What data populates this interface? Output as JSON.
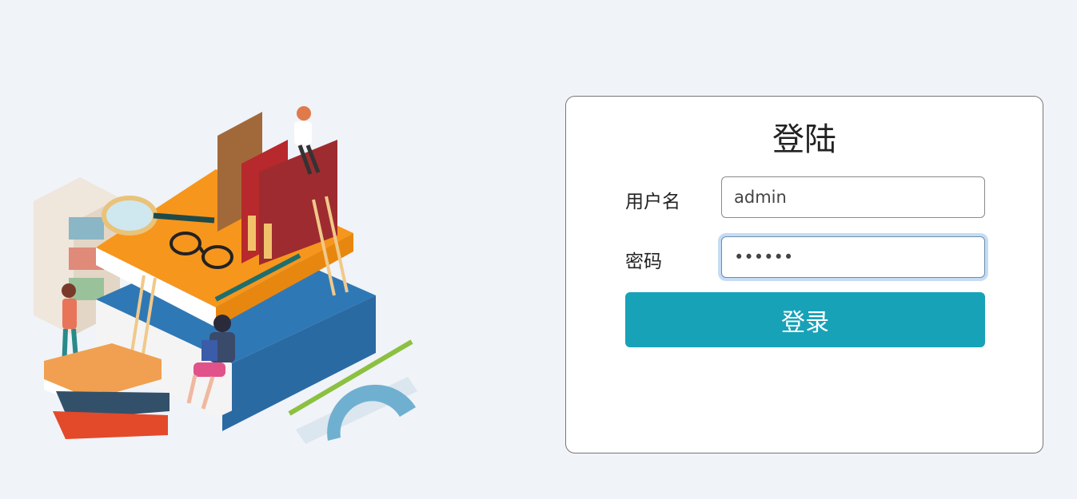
{
  "login": {
    "title": "登陆",
    "username_label": "用户名",
    "username_value": "admin",
    "password_label": "密码",
    "password_value": "000000",
    "submit_label": "登录"
  },
  "colors": {
    "background": "#f0f3f8",
    "button": "#17a2b8",
    "focus_ring": "#c4dcf4"
  }
}
